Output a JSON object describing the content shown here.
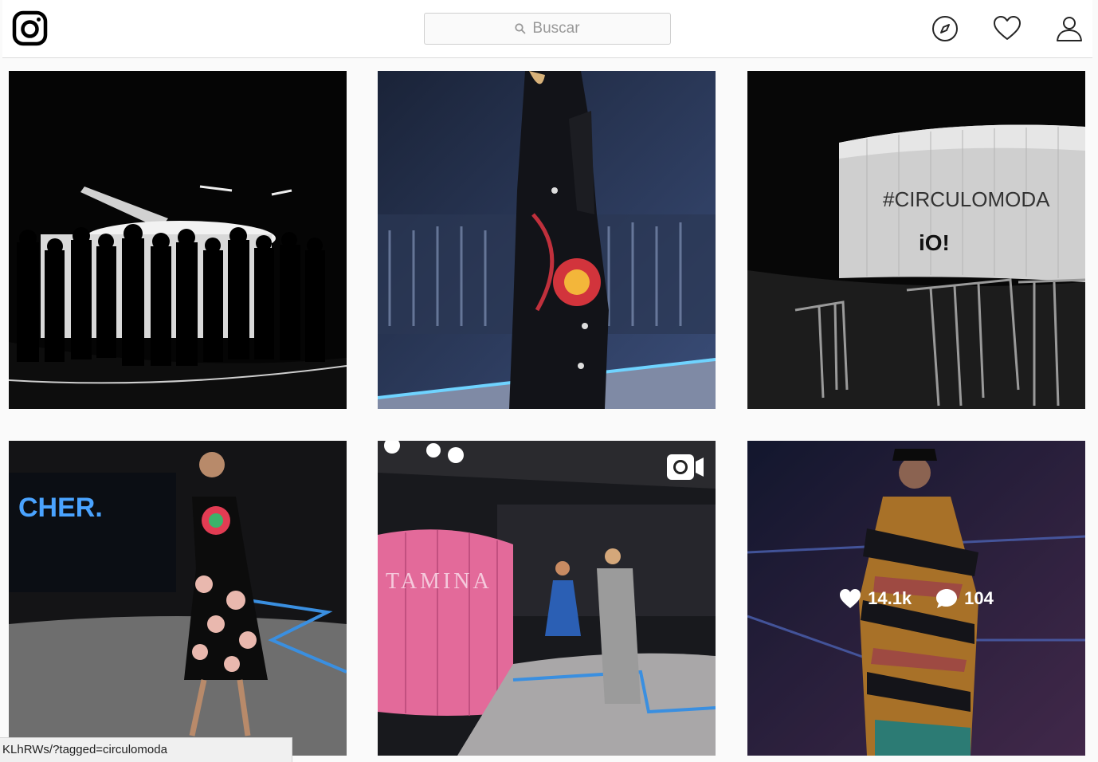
{
  "header": {
    "logo_icon": "instagram-camera-icon",
    "search_placeholder": "Buscar",
    "search_icon": "magnifier-icon",
    "nav_icons": [
      "compass-icon",
      "heart-icon",
      "profile-icon"
    ]
  },
  "posts": [
    {
      "name": "post-runway-silhouettes",
      "type": "image"
    },
    {
      "name": "post-model-kimono",
      "type": "image"
    },
    {
      "name": "post-circulomoda-stage",
      "type": "image",
      "stage_text": "#CIRCULOMODA",
      "stage_logo": "iO!"
    },
    {
      "name": "post-model-polka-dress",
      "type": "image",
      "screen_text": "CHER."
    },
    {
      "name": "post-pink-runway",
      "type": "video",
      "wall_text": "TAMINA",
      "badge_icon": "video-camera-icon"
    },
    {
      "name": "post-model-print-dress",
      "type": "image",
      "hovered": true,
      "likes": "14.1k",
      "comments": "104"
    }
  ],
  "status_bar": {
    "url": "KLhRWs/?tagged=circulomoda"
  },
  "colors": {
    "accent_blue": "#3a8fe0",
    "runway_pink": "#e36a9a",
    "border": "#dbdbdb"
  }
}
